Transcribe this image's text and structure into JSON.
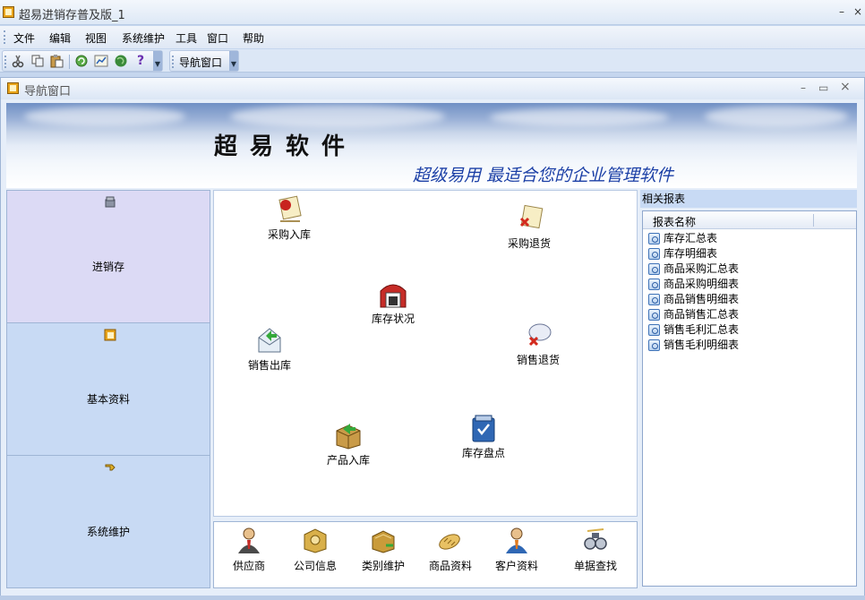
{
  "app": {
    "title": "超易进销存普及版_1",
    "minimize_glyph": "–",
    "close_glyph": "×"
  },
  "menu": {
    "items": [
      {
        "label": "文件"
      },
      {
        "label": "编辑"
      },
      {
        "label": "视图"
      },
      {
        "label": "系统维护"
      },
      {
        "label": "工具"
      },
      {
        "label": "窗口"
      },
      {
        "label": "帮助"
      }
    ]
  },
  "toolbar": {
    "buttons": [
      "cut-icon",
      "copy-icon",
      "paste-icon",
      "refresh-icon",
      "chart-icon",
      "globe-icon",
      "help-icon"
    ],
    "help_glyph": "?",
    "nav_window_label": "导航窗口"
  },
  "nav_window": {
    "title": "导航窗口",
    "min_glyph": "–",
    "restore_glyph": "▭",
    "close_glyph": "×"
  },
  "banner": {
    "brand": "超易软件",
    "slogan": "超级易用  最适合您的企业管理软件"
  },
  "left_nav": {
    "items": [
      {
        "label": "进销存",
        "icon": "box-icon",
        "active": true
      },
      {
        "label": "基本资料",
        "icon": "folder-icon",
        "active": false
      },
      {
        "label": "系统维护",
        "icon": "tools-icon",
        "active": false
      }
    ]
  },
  "modules": {
    "purchase_in": "采购入库",
    "purchase_return": "采购退货",
    "inventory_status": "库存状况",
    "sales_out": "销售出库",
    "sales_return": "销售退货",
    "product_in": "产品入库",
    "stock_check": "库存盘点"
  },
  "quick_bar": {
    "items": [
      {
        "label": "供应商",
        "icon": "person-icon"
      },
      {
        "label": "公司信息",
        "icon": "book-icon"
      },
      {
        "label": "类别维护",
        "icon": "book-icon"
      },
      {
        "label": "商品资料",
        "icon": "bread-icon"
      },
      {
        "label": "客户资料",
        "icon": "person-icon"
      },
      {
        "label": "单据查找",
        "icon": "binoculars-icon"
      }
    ]
  },
  "reports": {
    "title": "相关报表",
    "column": "报表名称",
    "rows": [
      "库存汇总表",
      "库存明细表",
      "商品采购汇总表",
      "商品采购明细表",
      "商品销售明细表",
      "商品销售汇总表",
      "销售毛利汇总表",
      "销售毛利明细表"
    ]
  }
}
